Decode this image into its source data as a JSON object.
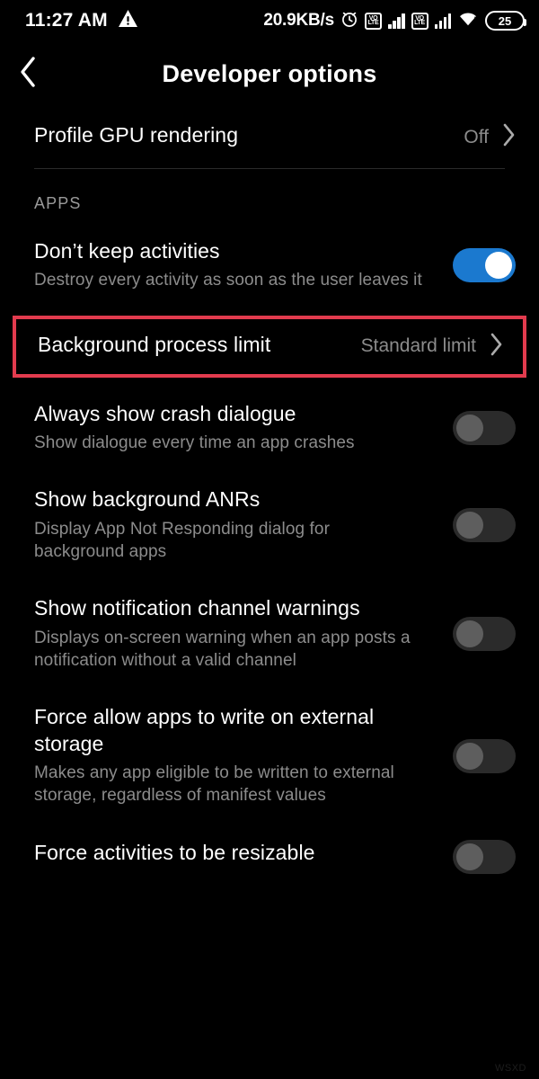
{
  "status_bar": {
    "time": "11:27 AM",
    "warning_icon": "warning-triangle-icon",
    "network_speed": "20.9KB/s",
    "alarm_icon": "alarm-clock-icon",
    "volte_label_top": "VO",
    "volte_label_bottom": "LTE",
    "signal_icon": "signal-bars-icon",
    "wifi_icon": "wifi-icon",
    "battery_level": "25"
  },
  "app_bar": {
    "back_icon": "back-chevron-icon",
    "title": "Developer options"
  },
  "rows": [
    {
      "title": "Profile GPU rendering",
      "subtitle": "",
      "value": "Off",
      "control": "chevron"
    }
  ],
  "section": {
    "apps_header": "APPS"
  },
  "apps_rows": [
    {
      "title": "Don’t keep activities",
      "subtitle": "Destroy every activity as soon as the user leaves it",
      "value": "",
      "control": "switch",
      "switch_state": "on"
    },
    {
      "title": "Background process limit",
      "subtitle": "",
      "value": "Standard limit",
      "control": "chevron",
      "highlighted": true
    },
    {
      "title": "Always show crash dialogue",
      "subtitle": "Show dialogue every time an app crashes",
      "value": "",
      "control": "switch",
      "switch_state": "off"
    },
    {
      "title": "Show background ANRs",
      "subtitle": "Display App Not Responding dialog for background apps",
      "value": "",
      "control": "switch",
      "switch_state": "off"
    },
    {
      "title": "Show notification channel warnings",
      "subtitle": "Displays on-screen warning when an app posts a notification without a valid channel",
      "value": "",
      "control": "switch",
      "switch_state": "off"
    },
    {
      "title": "Force allow apps to write on external storage",
      "subtitle": "Makes any app eligible to be written to external storage, regardless of manifest values",
      "value": "",
      "control": "switch",
      "switch_state": "off"
    },
    {
      "title": "Force activities to be resizable",
      "subtitle": "",
      "value": "",
      "control": "switch",
      "switch_state": "off"
    }
  ],
  "watermark": "WSXD",
  "colors": {
    "background": "#000000",
    "switch_on": "#1b79cf",
    "switch_off_track": "#2b2b2b",
    "switch_off_thumb": "#5e5e5e",
    "highlight_border": "#e23b4e",
    "secondary_text": "#8c8c8c",
    "divider": "#2b2b2b"
  }
}
